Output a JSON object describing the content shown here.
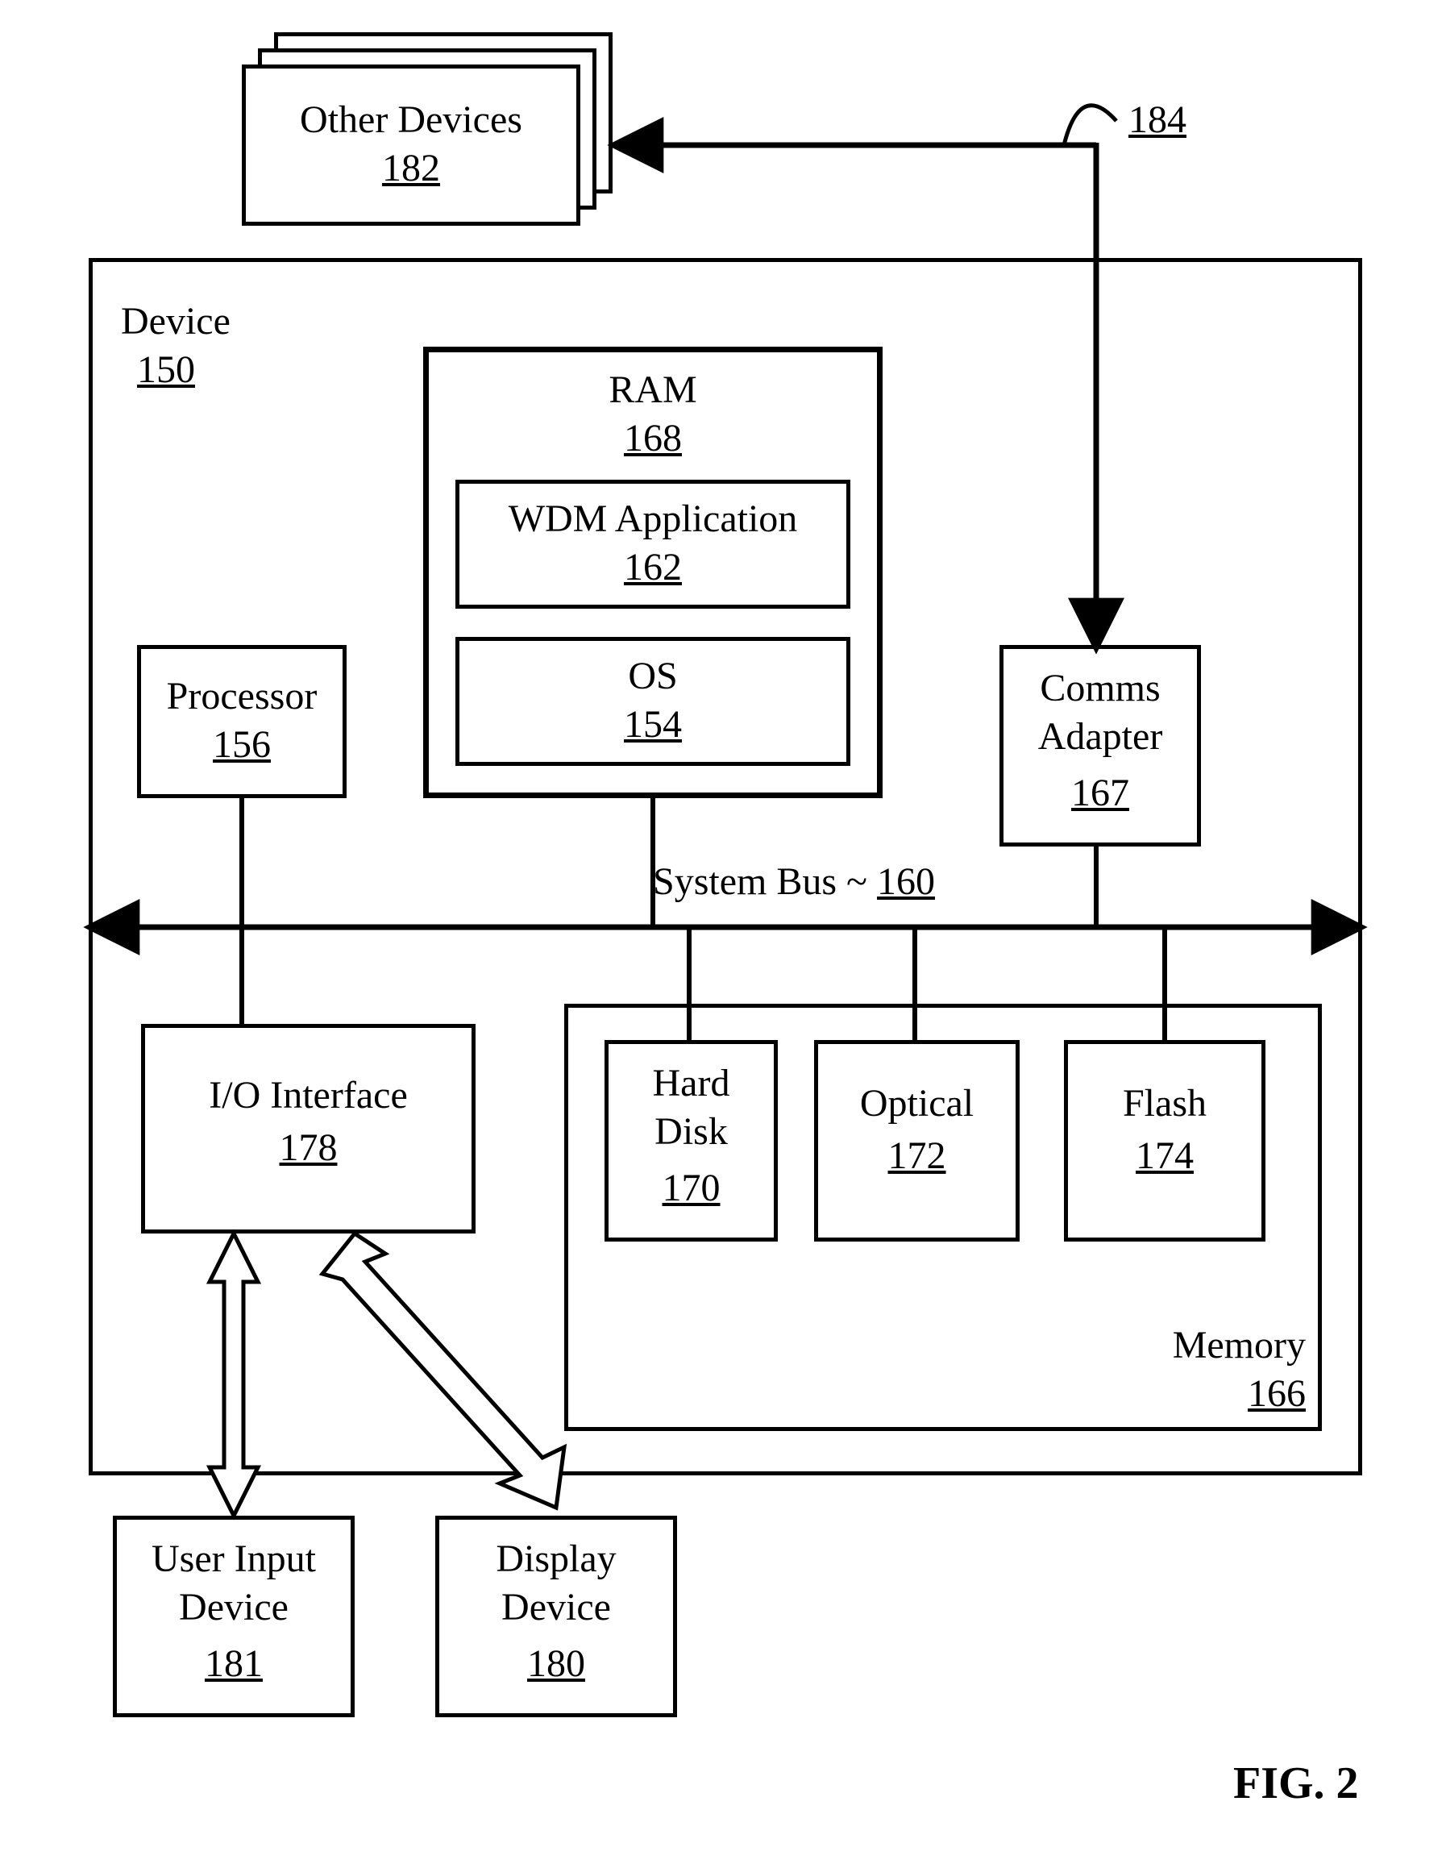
{
  "figure_label": "FIG. 2",
  "external_ref": "184",
  "other_devices": {
    "title": "Other Devices",
    "num": "182"
  },
  "device": {
    "title": "Device",
    "num": "150"
  },
  "ram": {
    "title": "RAM",
    "num": "168"
  },
  "wdm": {
    "title": "WDM Application",
    "num": "162"
  },
  "os": {
    "title": "OS",
    "num": "154"
  },
  "processor": {
    "title": "Processor",
    "num": "156"
  },
  "comms": {
    "title1": "Comms",
    "title2": "Adapter",
    "num": "167"
  },
  "bus": {
    "label": "System Bus ~ ",
    "num": "160"
  },
  "io": {
    "title": "I/O Interface",
    "num": "178"
  },
  "hdd": {
    "title1": "Hard",
    "title2": "Disk",
    "num": "170"
  },
  "optical": {
    "title": "Optical",
    "num": "172"
  },
  "flash": {
    "title": "Flash",
    "num": "174"
  },
  "memory": {
    "title": "Memory",
    "num": "166"
  },
  "user_input": {
    "title1": "User Input",
    "title2": "Device",
    "num": "181"
  },
  "display": {
    "title1": "Display",
    "title2": "Device",
    "num": "180"
  }
}
